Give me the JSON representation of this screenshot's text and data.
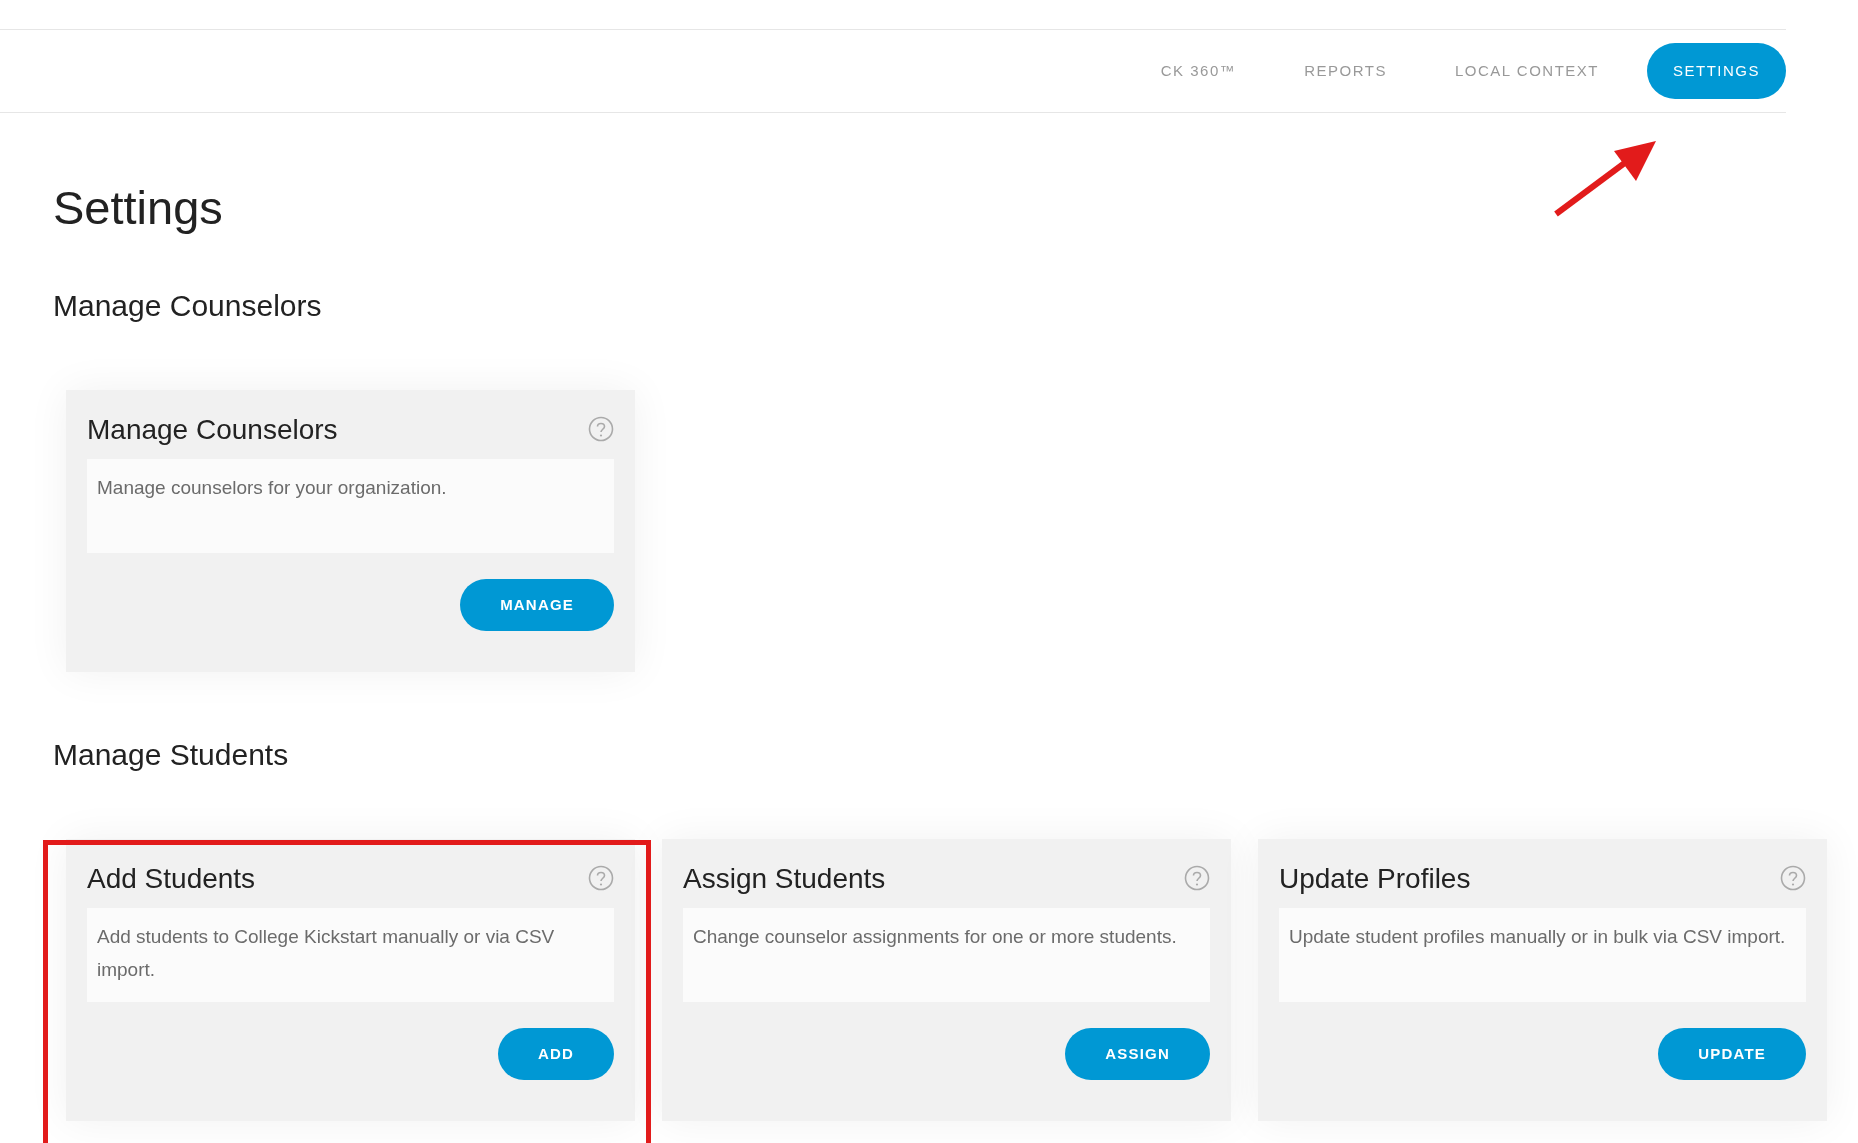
{
  "nav": [
    {
      "label": "CK 360™",
      "selected": false
    },
    {
      "label": "REPORTS",
      "selected": false
    },
    {
      "label": "LOCAL CONTEXT",
      "selected": false
    },
    {
      "label": "SETTINGS",
      "selected": true
    }
  ],
  "page_title": "Settings",
  "sections": [
    {
      "heading": "Manage Counselors",
      "cards": [
        {
          "title": "Manage Counselors",
          "description": "Manage counselors for your organization.",
          "button": "MANAGE"
        }
      ]
    },
    {
      "heading": "Manage Students",
      "cards": [
        {
          "title": "Add Students",
          "description": "Add students to College Kickstart manually or via CSV import.",
          "button": "ADD"
        },
        {
          "title": "Assign Students",
          "description": "Change counselor assignments for one or more students.",
          "button": "ASSIGN"
        },
        {
          "title": "Update Profiles",
          "description": "Update student profiles manually or in bulk via CSV import.",
          "button": "UPDATE"
        }
      ]
    }
  ]
}
